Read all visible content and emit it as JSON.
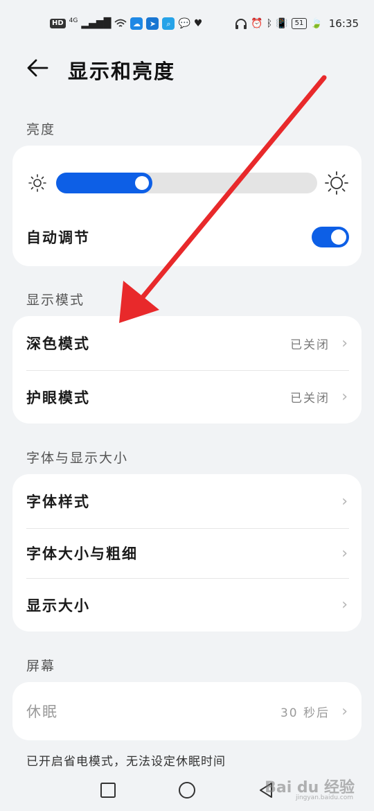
{
  "statusbar": {
    "hd": "HD",
    "network": "4G",
    "battery": "51",
    "time": "16:35"
  },
  "header": {
    "title": "显示和亮度"
  },
  "brightness": {
    "section_label": "亮度",
    "level": 0.37,
    "auto_label": "自动调节",
    "auto_enabled": true
  },
  "display_mode": {
    "section_label": "显示模式",
    "items": [
      {
        "label": "深色模式",
        "value": "已关闭"
      },
      {
        "label": "护眼模式",
        "value": "已关闭"
      }
    ]
  },
  "font_display": {
    "section_label": "字体与显示大小",
    "items": [
      {
        "label": "字体样式"
      },
      {
        "label": "字体大小与粗细"
      },
      {
        "label": "显示大小"
      }
    ]
  },
  "screen": {
    "section_label": "屏幕",
    "sleep_label": "休眠",
    "sleep_value": "30 秒后",
    "note": "已开启省电模式，无法设定休眠时间"
  },
  "watermark": {
    "main": "Bai du 经验",
    "sub": "jingyan.baidu.com"
  },
  "colors": {
    "accent": "#0d5fe6",
    "annotation": "#e8292b",
    "background": "#f1f3f5"
  }
}
